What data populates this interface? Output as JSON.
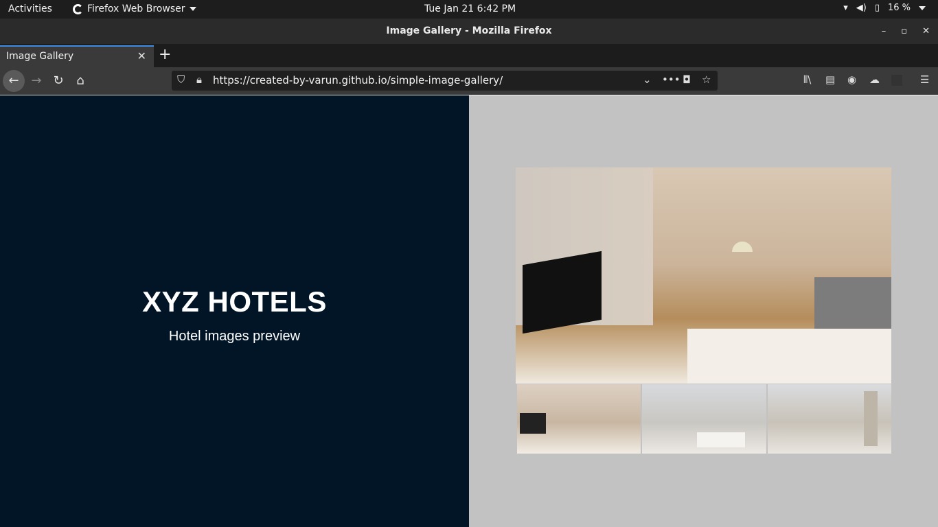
{
  "system_bar": {
    "activities": "Activities",
    "app_name": "Firefox Web Browser",
    "clock": "Tue Jan 21   6:42 PM",
    "battery": "16 %"
  },
  "window": {
    "title": "Image Gallery - Mozilla Firefox"
  },
  "tabs": [
    {
      "label": "Image Gallery",
      "active": true
    }
  ],
  "navbar": {
    "url": "https://created-by-varun.github.io/simple-image-gallery/"
  },
  "page": {
    "heading": "XYZ HOTELS",
    "subheading": "Hotel images preview",
    "left_bg": "#011526",
    "right_bg": "#c2c2c2"
  },
  "gallery": {
    "thumbnails": [
      "thumbnail-1",
      "thumbnail-2",
      "thumbnail-3"
    ]
  }
}
